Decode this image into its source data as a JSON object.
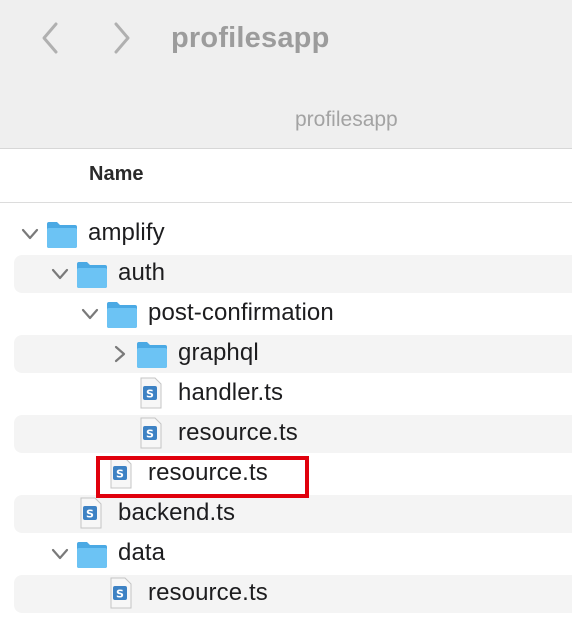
{
  "window": {
    "title": "profilesapp",
    "path_label": "profilesapp"
  },
  "icons": {
    "back": "chevron-left-icon",
    "forward": "chevron-right-icon",
    "folder": "folder-icon",
    "typescript_file": "typescript-file-icon",
    "chevron_down": "chevron-down-icon",
    "chevron_right": "chevron-right-icon"
  },
  "colors": {
    "folder": "#5ab8ee",
    "highlight_box": "#e0000c",
    "row_stripe": "#f4f4f4"
  },
  "list": {
    "column_header": "Name",
    "items": [
      {
        "label": "amplify",
        "kind": "folder",
        "expanded": true
      },
      {
        "label": "auth",
        "kind": "folder",
        "expanded": true
      },
      {
        "label": "post-confirmation",
        "kind": "folder",
        "expanded": true
      },
      {
        "label": "graphql",
        "kind": "folder",
        "expanded": false
      },
      {
        "label": "handler.ts",
        "kind": "file"
      },
      {
        "label": "resource.ts",
        "kind": "file"
      },
      {
        "label": "resource.ts",
        "kind": "file",
        "highlighted": true
      },
      {
        "label": "backend.ts",
        "kind": "file"
      },
      {
        "label": "data",
        "kind": "folder",
        "expanded": true
      },
      {
        "label": "resource.ts",
        "kind": "file"
      }
    ]
  }
}
